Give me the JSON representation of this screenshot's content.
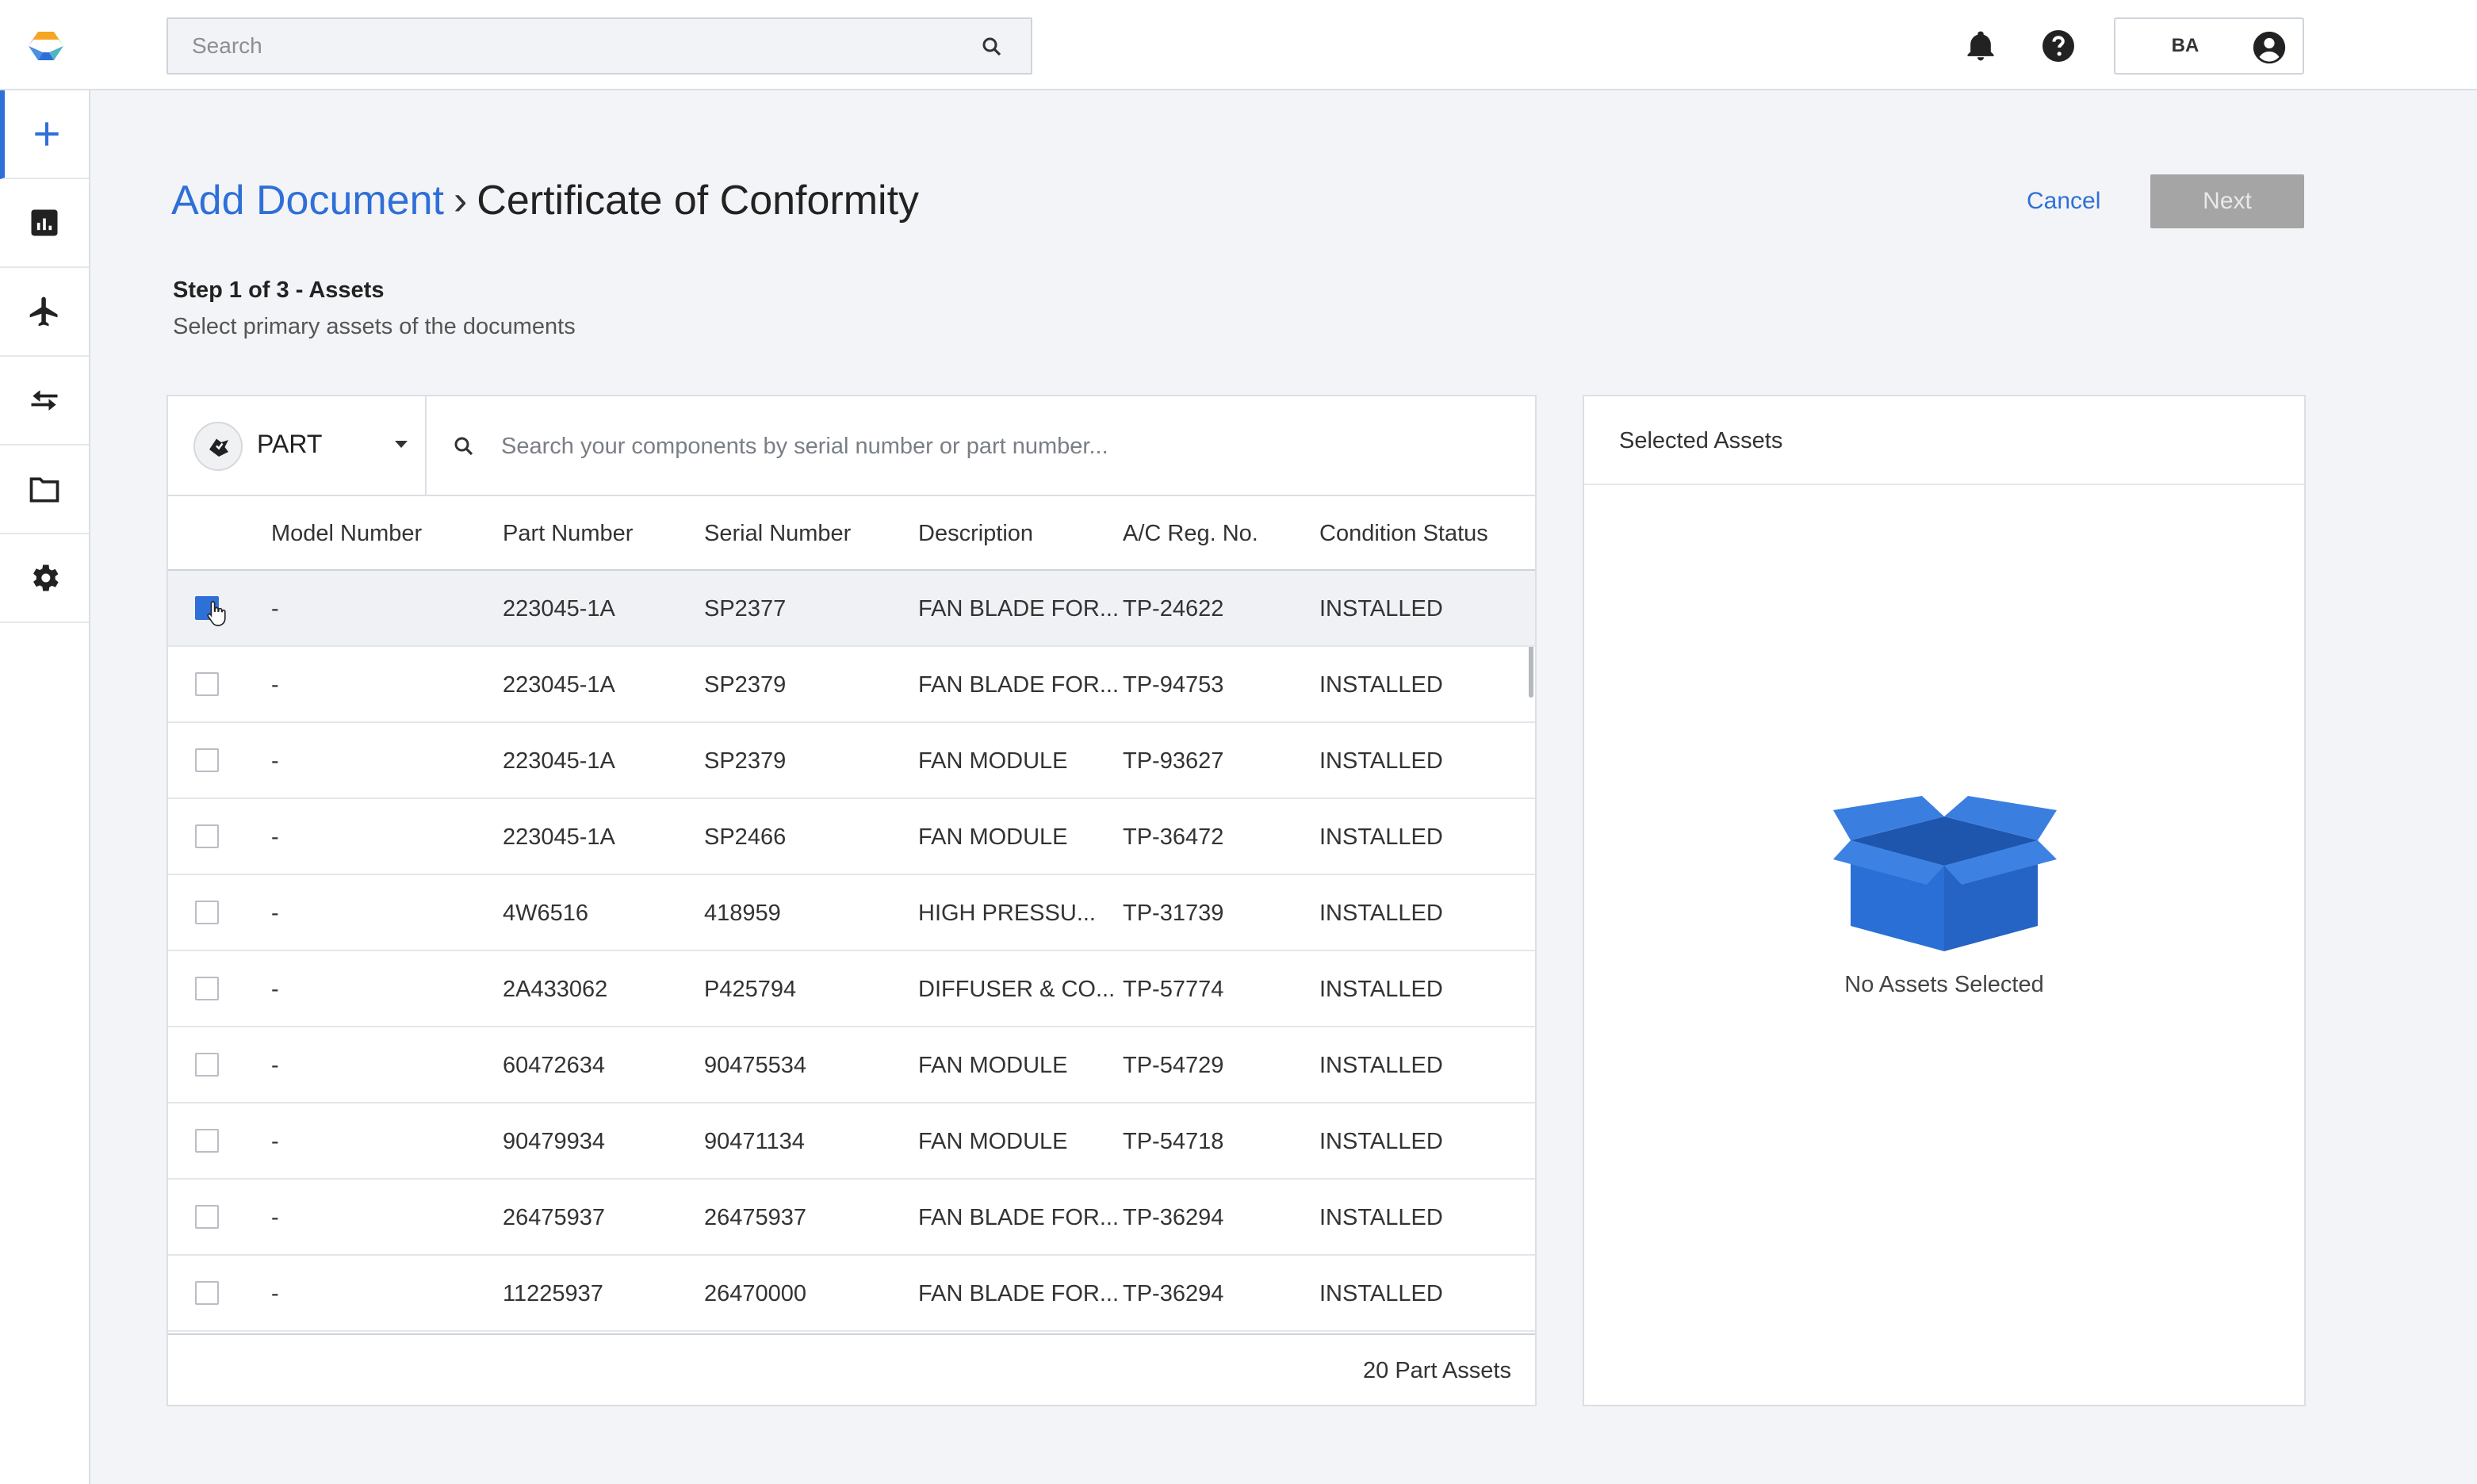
{
  "search": {
    "placeholder": "Search"
  },
  "user": {
    "initials": "BA"
  },
  "nav": [
    "add",
    "dashboard",
    "aircraft",
    "transfer",
    "documents",
    "settings"
  ],
  "header": {
    "breadcrumb_parent": "Add Document",
    "breadcrumb_separator": "›",
    "breadcrumb_current": "Certificate of Conformity",
    "cancel_label": "Cancel",
    "next_label": "Next"
  },
  "step": {
    "title": "Step 1 of 3 - Assets",
    "subtitle": "Select primary assets of the documents"
  },
  "filter": {
    "type": "PART",
    "placeholder": "Search your components by serial number or part number..."
  },
  "table": {
    "columns": [
      "Model Number",
      "Part Number",
      "Serial Number",
      "Description",
      "A/C Reg. No.",
      "Condition Status"
    ],
    "rows": [
      {
        "checked": true,
        "model": "-",
        "part": "223045-1A",
        "serial": "SP2377",
        "desc": "FAN BLADE FOR...",
        "reg": "TP-24622",
        "status": "INSTALLED"
      },
      {
        "checked": false,
        "model": "-",
        "part": "223045-1A",
        "serial": "SP2379",
        "desc": "FAN BLADE FOR...",
        "reg": "TP-94753",
        "status": "INSTALLED"
      },
      {
        "checked": false,
        "model": "-",
        "part": "223045-1A",
        "serial": "SP2379",
        "desc": "FAN MODULE",
        "reg": "TP-93627",
        "status": "INSTALLED"
      },
      {
        "checked": false,
        "model": "-",
        "part": "223045-1A",
        "serial": "SP2466",
        "desc": "FAN MODULE",
        "reg": "TP-36472",
        "status": "INSTALLED"
      },
      {
        "checked": false,
        "model": "-",
        "part": "4W6516",
        "serial": "418959",
        "desc": "HIGH PRESSU...",
        "reg": "TP-31739",
        "status": "INSTALLED"
      },
      {
        "checked": false,
        "model": "-",
        "part": "2A433062",
        "serial": "P425794",
        "desc": "DIFFUSER & CO...",
        "reg": "TP-57774",
        "status": "INSTALLED"
      },
      {
        "checked": false,
        "model": "-",
        "part": "60472634",
        "serial": "90475534",
        "desc": "FAN MODULE",
        "reg": "TP-54729",
        "status": "INSTALLED"
      },
      {
        "checked": false,
        "model": "-",
        "part": "90479934",
        "serial": "90471134",
        "desc": "FAN MODULE",
        "reg": "TP-54718",
        "status": "INSTALLED"
      },
      {
        "checked": false,
        "model": "-",
        "part": "26475937",
        "serial": "26475937",
        "desc": "FAN BLADE FOR...",
        "reg": "TP-36294",
        "status": "INSTALLED"
      },
      {
        "checked": false,
        "model": "-",
        "part": "11225937",
        "serial": "26470000",
        "desc": "FAN BLADE FOR...",
        "reg": "TP-36294",
        "status": "INSTALLED"
      }
    ],
    "footer": "20 Part Assets"
  },
  "selected": {
    "title": "Selected Assets",
    "empty_text": "No Assets Selected"
  },
  "colors": {
    "accent": "#2f6fd8",
    "next_disabled": "#a5a5a5",
    "box_blue": "#2a6fd6"
  }
}
